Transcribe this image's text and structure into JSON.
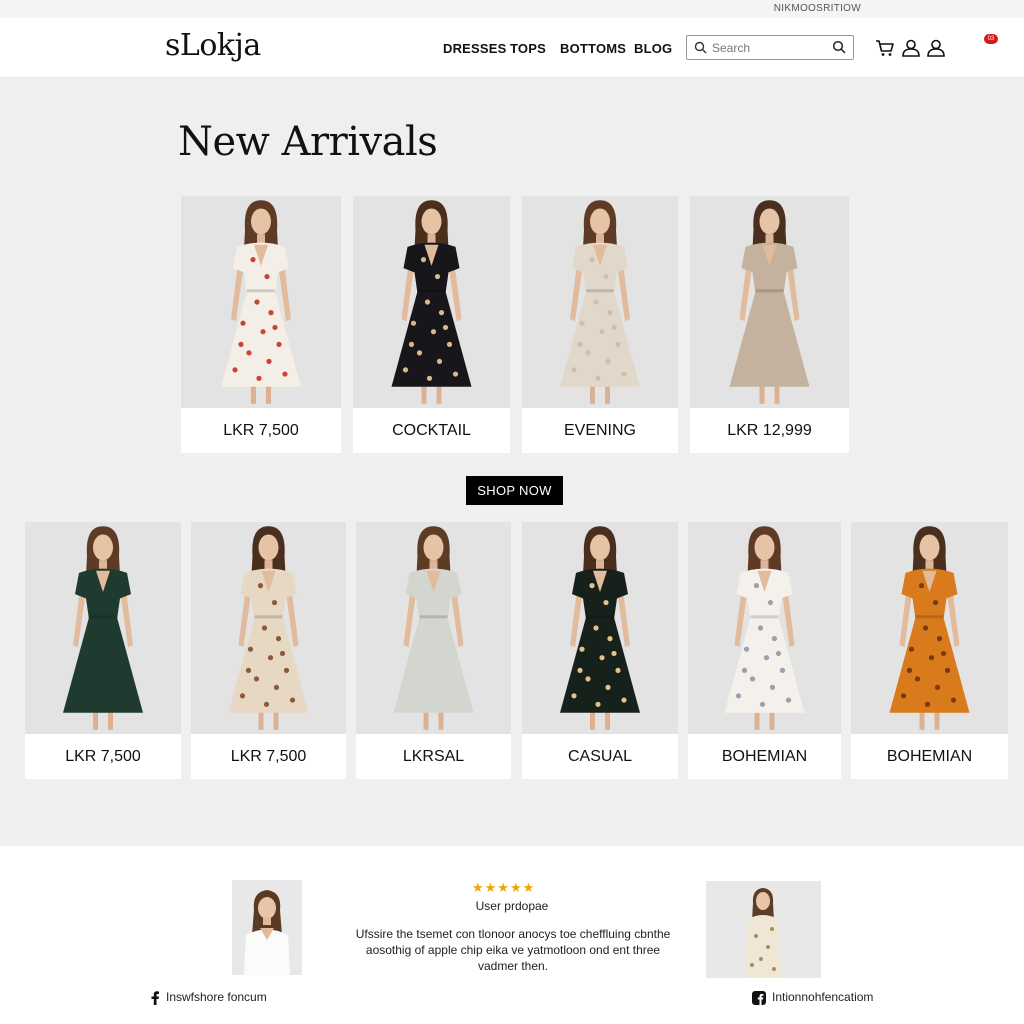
{
  "topbar": {
    "text": "NIKMOOSRITIOW"
  },
  "header": {
    "logo": "sLokja",
    "nav": [
      "DRESSES",
      "TOPS",
      "BOTTOMS",
      "BLOG"
    ],
    "search": {
      "placeholder": "Search",
      "value": ""
    },
    "icons": [
      "cart-icon",
      "user-icon",
      "account-icon"
    ],
    "badge": "03"
  },
  "main": {
    "title": "New Arrivals",
    "row1": [
      {
        "label": "LKR 7,500",
        "dress": "white-floral",
        "color": "#f3eee6",
        "pattern": "#c8443a"
      },
      {
        "label": "COCKTAIL",
        "dress": "black-floral",
        "color": "#17161a",
        "pattern": "#d7b98a"
      },
      {
        "label": "EVENING",
        "dress": "beige-lace",
        "color": "#e2d8c9",
        "pattern": "#cdbfaa"
      },
      {
        "label": "LKR 12,999",
        "dress": "taupe-plain",
        "color": "#c4b19e",
        "pattern": ""
      }
    ],
    "shop_now": "SHOP NOW",
    "row2": [
      {
        "label": "LKR 7,500",
        "dress": "dark-green",
        "color": "#1f3a2f",
        "pattern": ""
      },
      {
        "label": "LKR 7,500",
        "dress": "beige-floral",
        "color": "#e6d8c3",
        "pattern": "#8a5a3a"
      },
      {
        "label": "LKRSAL",
        "dress": "sage-plain",
        "color": "#d3d6cf",
        "pattern": ""
      },
      {
        "label": "CASUAL",
        "dress": "black-floral",
        "color": "#17211c",
        "pattern": "#e2c28a"
      },
      {
        "label": "BOHEMIAN",
        "dress": "white-floral",
        "color": "#f4f1ec",
        "pattern": "#9aa0b0"
      },
      {
        "label": "BOHEMIAN",
        "dress": "orange-floral",
        "color": "#d97a1c",
        "pattern": "#7a3a10"
      }
    ]
  },
  "footer": {
    "stars": "★★★★★",
    "reviewer": "User prdopae",
    "review": "Ufssire the tsemet con tlonoor anocys toe cheffluing cbnthe aosothig of apple chip eika ve yatmotloon ond ent three vadmer then.",
    "social_left": "Inswfshore foncum",
    "social_right": "Intionnohfencatiom"
  }
}
